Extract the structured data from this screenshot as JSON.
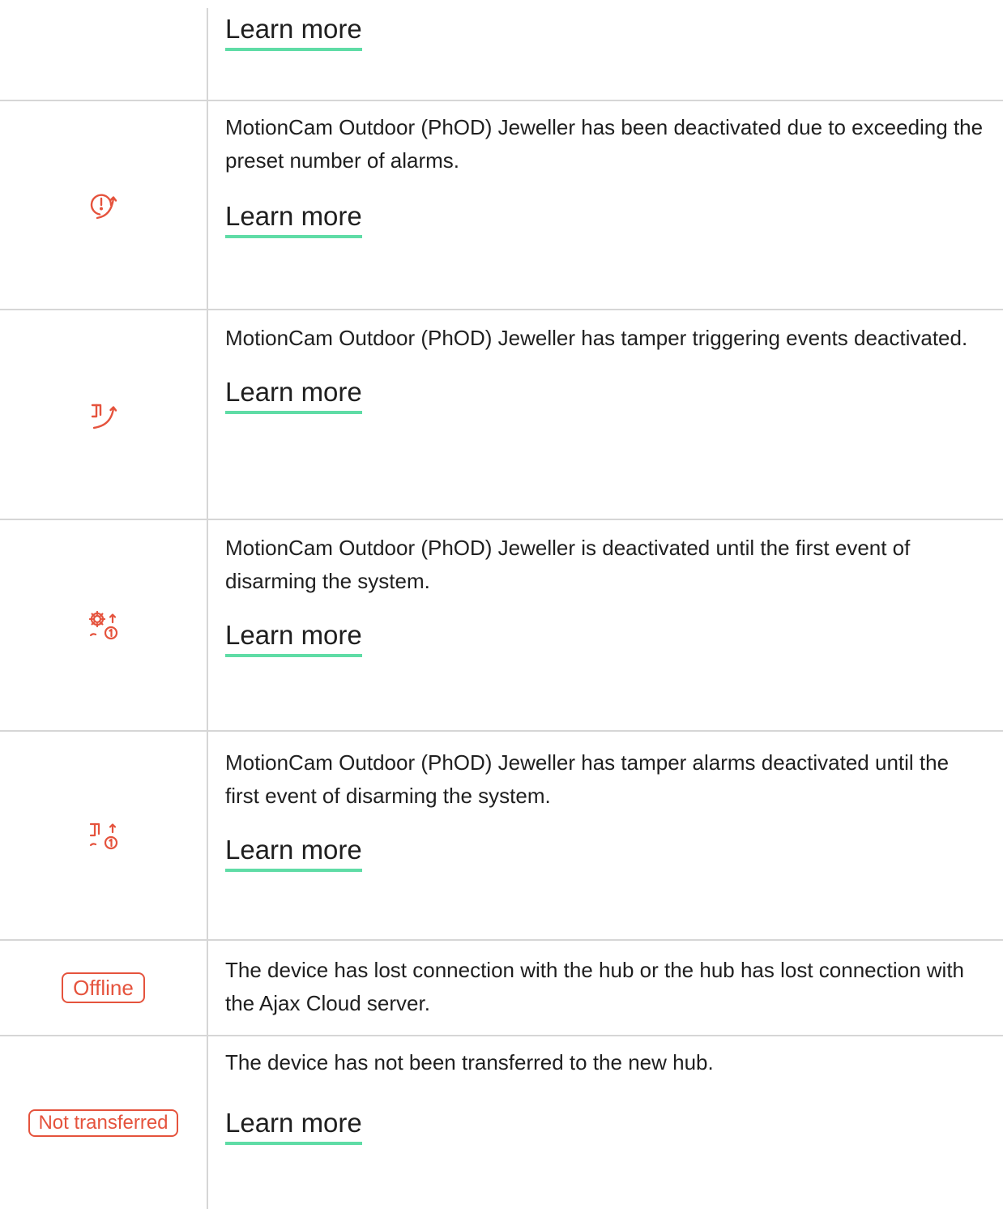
{
  "rows": [
    {
      "learn_more": "Learn more"
    },
    {
      "icon": "deactivated-alarms-icon",
      "description": "MotionCam Outdoor (PhOD) Jeweller has been deactivated due to exceeding the preset number of alarms.",
      "learn_more": "Learn more"
    },
    {
      "icon": "tamper-deactivated-icon",
      "description": "MotionCam Outdoor (PhOD) Jeweller has tamper triggering events deactivated.",
      "learn_more": "Learn more"
    },
    {
      "icon": "deactivated-until-disarm-icon",
      "description": "MotionCam Outdoor (PhOD) Jeweller is deactivated until the first event of disarming the system.",
      "learn_more": "Learn more"
    },
    {
      "icon": "tamper-deactivated-until-disarm-icon",
      "description": "MotionCam Outdoor (PhOD) Jeweller has tamper alarms deactivated until the first event of disarming the system.",
      "learn_more": "Learn more"
    },
    {
      "badge": "Offline",
      "description": "The device has lost connection with the hub or the hub has lost connection with the Ajax Cloud server."
    },
    {
      "badge": "Not transferred",
      "description": "The device has not been transferred to the new hub.",
      "learn_more": "Learn more"
    }
  ],
  "colors": {
    "accent": "#e5533d",
    "link_underline": "#5fdca6",
    "divider": "#d6d6d6"
  }
}
